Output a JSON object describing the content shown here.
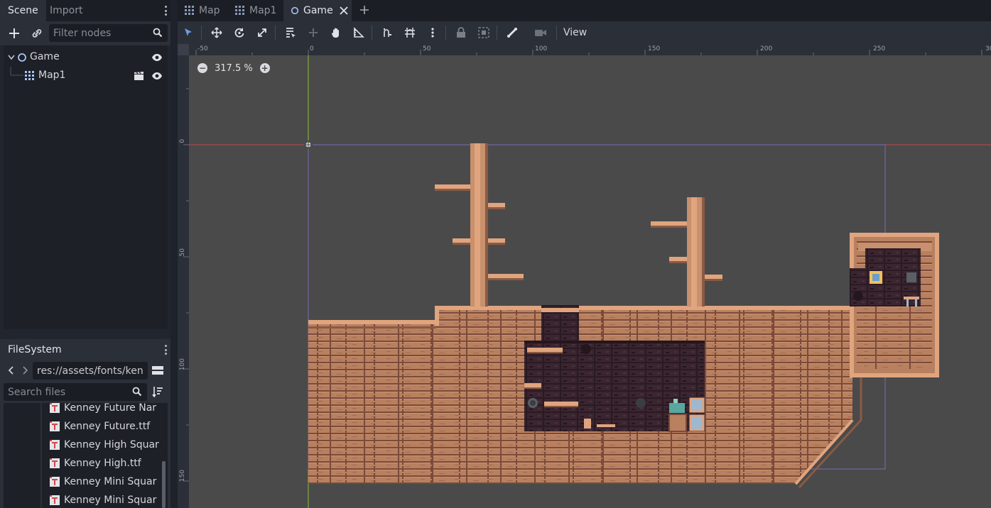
{
  "scene_dock": {
    "tabs": [
      {
        "label": "Scene"
      },
      {
        "label": "Import"
      }
    ],
    "filter_placeholder": "Filter nodes",
    "tree": [
      {
        "label": "Game"
      },
      {
        "label": "Map1"
      }
    ]
  },
  "filesystem_dock": {
    "tab_label": "FileSystem",
    "path": "res://assets/fonts/ken",
    "search_placeholder": "Search files",
    "files": [
      {
        "name": "Kenney Future Nar"
      },
      {
        "name": "Kenney Future.ttf"
      },
      {
        "name": "Kenney High Squar"
      },
      {
        "name": "Kenney High.ttf"
      },
      {
        "name": "Kenney Mini Squar"
      },
      {
        "name": "Kenney Mini Squar"
      }
    ]
  },
  "editor_tabs": [
    {
      "label": "Map"
    },
    {
      "label": "Map1"
    },
    {
      "label": "Game"
    }
  ],
  "toolbar": {
    "view_label": "View"
  },
  "viewport": {
    "zoom": "317.5 %",
    "ruler_h": [
      "-50",
      "0",
      "50",
      "100",
      "150",
      "200",
      "250",
      "30"
    ],
    "ruler_v": [
      "0",
      "50",
      "100",
      "150"
    ]
  },
  "colors": {
    "accent": "#699ce8",
    "wood": "#b8805f",
    "wood_dark": "#8a5a44",
    "wood_light": "#e0a57e",
    "interior": "#3a2530",
    "axis_x": "#c0444d",
    "axis_y": "#8fbf3a"
  }
}
